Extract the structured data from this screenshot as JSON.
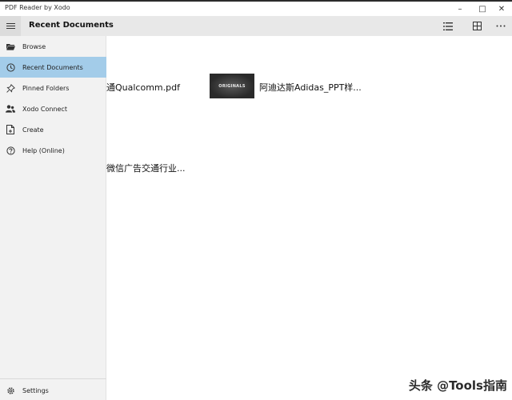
{
  "window": {
    "title": "PDF Reader by Xodo",
    "minimize": "–",
    "maximize": "□",
    "close": "✕"
  },
  "header": {
    "page_title": "Recent Documents",
    "icons": [
      "list-view-icon",
      "grid-view-icon",
      "more-icon"
    ]
  },
  "sidebar": {
    "items": [
      {
        "label": "Browse",
        "icon": "folder-icon"
      },
      {
        "label": "Recent Documents",
        "icon": "clock-icon",
        "active": true
      },
      {
        "label": "Pinned Folders",
        "icon": "pin-icon"
      },
      {
        "label": "Xodo Connect",
        "icon": "people-icon"
      },
      {
        "label": "Create",
        "icon": "new-document-icon"
      },
      {
        "label": "Help (Online)",
        "icon": "help-icon"
      }
    ],
    "settings": {
      "label": "Settings",
      "icon": "gear-icon"
    }
  },
  "documents": [
    {
      "name": "通Qualcomm.pdf"
    },
    {
      "name": "阿迪达斯Adidas_PPT样...",
      "thumbnail_text": "ORIGINALS"
    },
    {
      "name": "微信广告交通行业..."
    }
  ],
  "watermark": "头条 @Tools指南",
  "colors": {
    "accent": "#a3cce9",
    "sidebar_bg": "#f2f2f2",
    "header_bg": "#e8e8e8"
  }
}
